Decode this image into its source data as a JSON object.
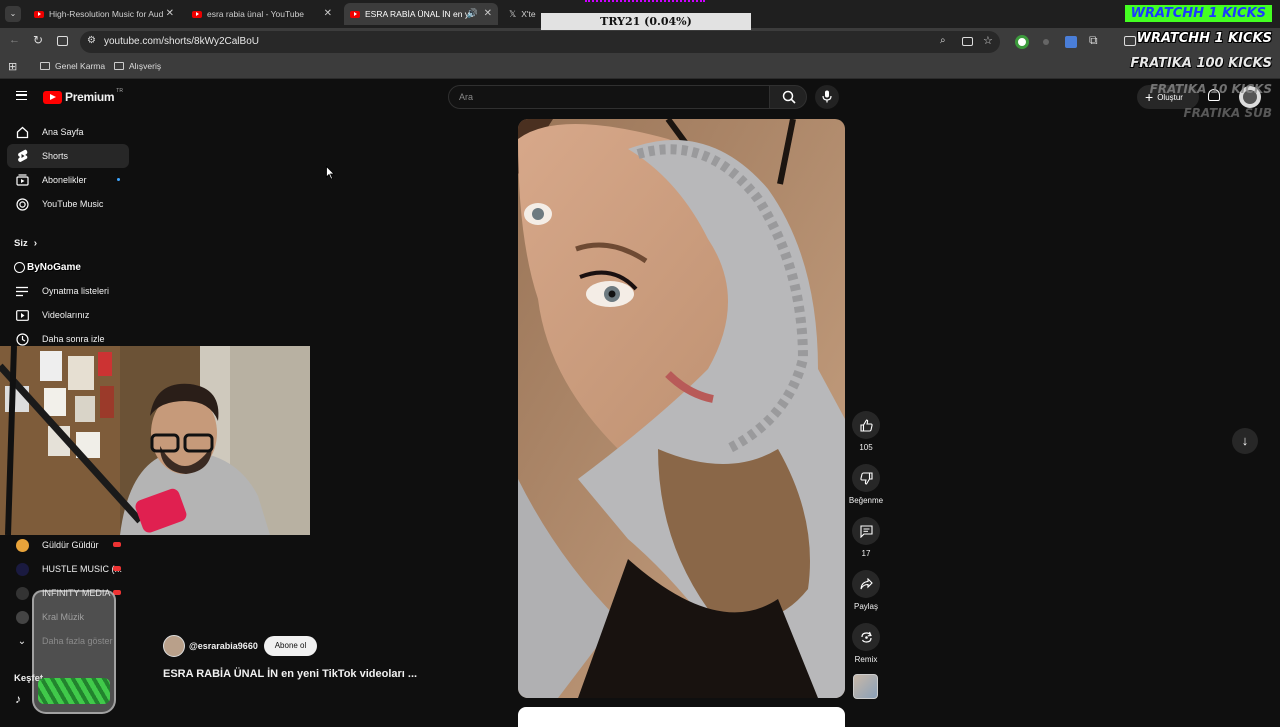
{
  "browser": {
    "tabs": [
      {
        "title": "High-Resolution Music for Aud"
      },
      {
        "title": "esra rabia ünal - YouTube"
      },
      {
        "title": "ESRA RABİA ÜNAL İN en ye"
      },
      {
        "title": "X'te"
      }
    ],
    "url": "youtube.com/shorts/8kWy2CalBoU",
    "bookmarks": [
      "Genel Karma",
      "Alışveriş"
    ]
  },
  "overlay": {
    "viewer_label": "TRY21 (0.04%)",
    "kicks": [
      "WRATCHH  1 KICKS",
      "WRATCHH  1 KICKS",
      "FRATIKA  100 KICKS",
      "FRATIKA  10 KICKS",
      "FRATIKA  SUB"
    ],
    "kick_colors": {
      "highlight": "#44ff22",
      "text": "#ffffff"
    },
    "webcam_name": "ByNoGame"
  },
  "youtube": {
    "logo": "Premium",
    "logo_badge": "TR",
    "search_placeholder": "Ara",
    "create_label": "Oluştur",
    "sidebar": {
      "main": [
        {
          "label": "Ana Sayfa",
          "icon": "home-icon"
        },
        {
          "label": "Shorts",
          "icon": "shorts-icon"
        },
        {
          "label": "Abonelikler",
          "icon": "subscriptions-icon"
        },
        {
          "label": "YouTube Music",
          "icon": "music-icon"
        }
      ],
      "you_header": "Siz",
      "you": [
        {
          "label": "Oynatma listeleri",
          "icon": "playlist-icon"
        },
        {
          "label": "Videolarınız",
          "icon": "video-icon"
        },
        {
          "label": "Daha sonra izle",
          "icon": "clock-icon"
        }
      ],
      "subscriptions": [
        {
          "label": "Güldür Güldür"
        },
        {
          "label": "HUSTLE MUSIC (..."
        },
        {
          "label": "INFINITY MEDIA"
        },
        {
          "label": "Kral Müzik"
        }
      ],
      "show_more": "Daha fazla göster",
      "explore_header": "Keşfet"
    },
    "short": {
      "channel": "@esrarabia9660",
      "subscribe_label": "Abone ol",
      "title": "ESRA RABİA ÜNAL İN en yeni TikTok videoları ...",
      "likes": "105",
      "dislike_label": "Beğenme",
      "comments": "17",
      "share_label": "Paylaş",
      "remix_label": "Remix"
    },
    "colors": {
      "brand": "#ff0000",
      "bg": "#0f0f0f"
    }
  }
}
